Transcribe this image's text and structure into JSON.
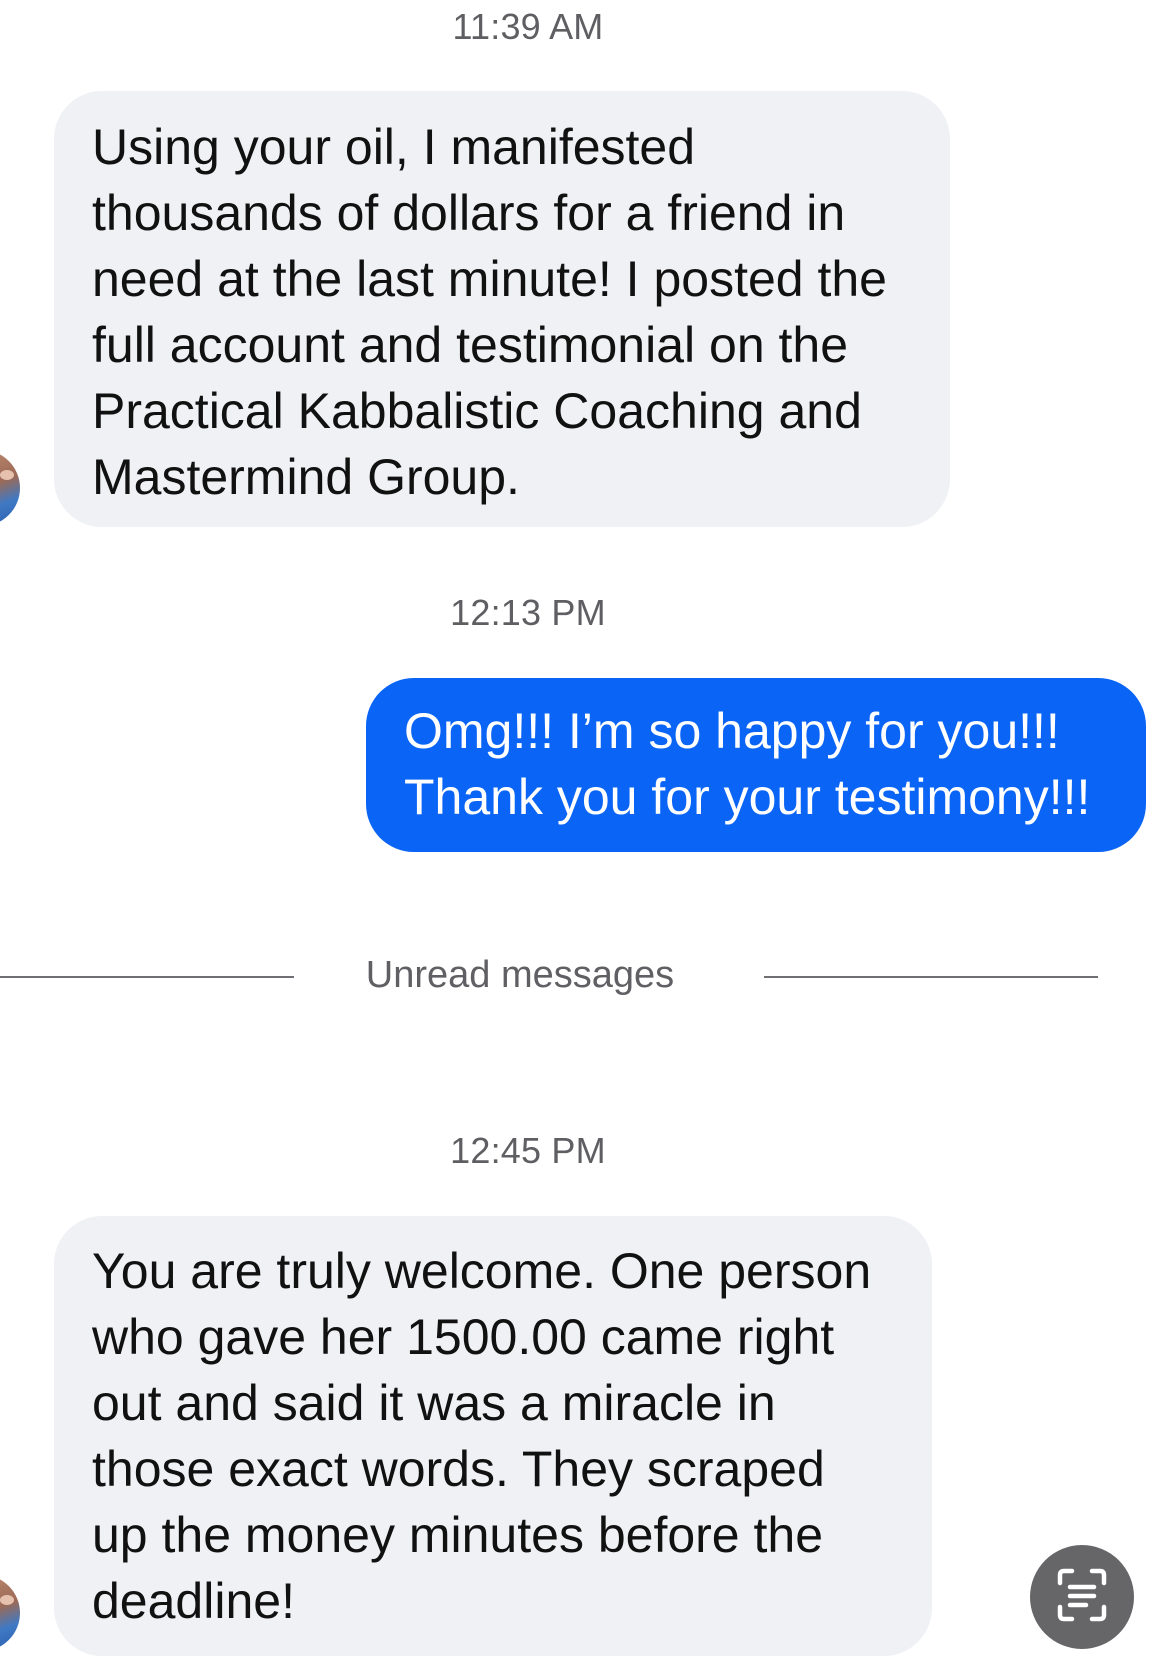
{
  "conversation": {
    "messages": [
      {
        "type": "timestamp",
        "text": "11:39 AM"
      },
      {
        "type": "incoming",
        "text": "Using your oil, I manifested thousands of dollars for a friend in need at the last minute! I posted the full account and testimonial on the Practical Kabbalistic Coaching and Mastermind Group."
      },
      {
        "type": "timestamp",
        "text": "12:13 PM"
      },
      {
        "type": "outgoing",
        "text": "Omg!!! I’m so happy for you!!! Thank you for your testimony!!!"
      },
      {
        "type": "divider",
        "text": "Unread messages"
      },
      {
        "type": "timestamp",
        "text": "12:45 PM"
      },
      {
        "type": "incoming",
        "text": "You are truly welcome. One person who gave her 1500.00 came right out and said it was a miracle in those exact words. They scraped up the money minutes before the deadline!"
      }
    ]
  },
  "scan_button": {
    "icon": "text-scan-icon",
    "color": "#666669"
  },
  "colors": {
    "incoming_bubble": "#f0f1f5",
    "outgoing_bubble": "#0a64f5",
    "divider": "#707074"
  }
}
